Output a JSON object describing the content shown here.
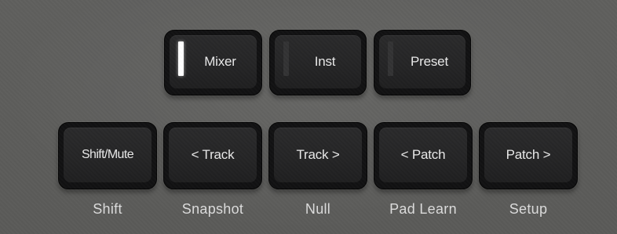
{
  "mode_buttons": [
    {
      "label": "Mixer",
      "led_on": true
    },
    {
      "label": "Inst",
      "led_on": false
    },
    {
      "label": "Preset",
      "led_on": false
    }
  ],
  "function_buttons": [
    {
      "label": "Shift/Mute",
      "secondary": "Shift"
    },
    {
      "label": "< Track",
      "secondary": "Snapshot"
    },
    {
      "label": "Track >",
      "secondary": "Null"
    },
    {
      "label": "< Patch",
      "secondary": "Pad Learn"
    },
    {
      "label": "Patch >",
      "secondary": "Setup"
    }
  ],
  "colors": {
    "panel": "#5d5d5b",
    "button_body": "#111112",
    "button_cap": "#272728",
    "led_on": "#ffffff",
    "led_off": "#333334",
    "label_text": "#e9e9e9",
    "sublabel_text": "#dcdcdc"
  }
}
